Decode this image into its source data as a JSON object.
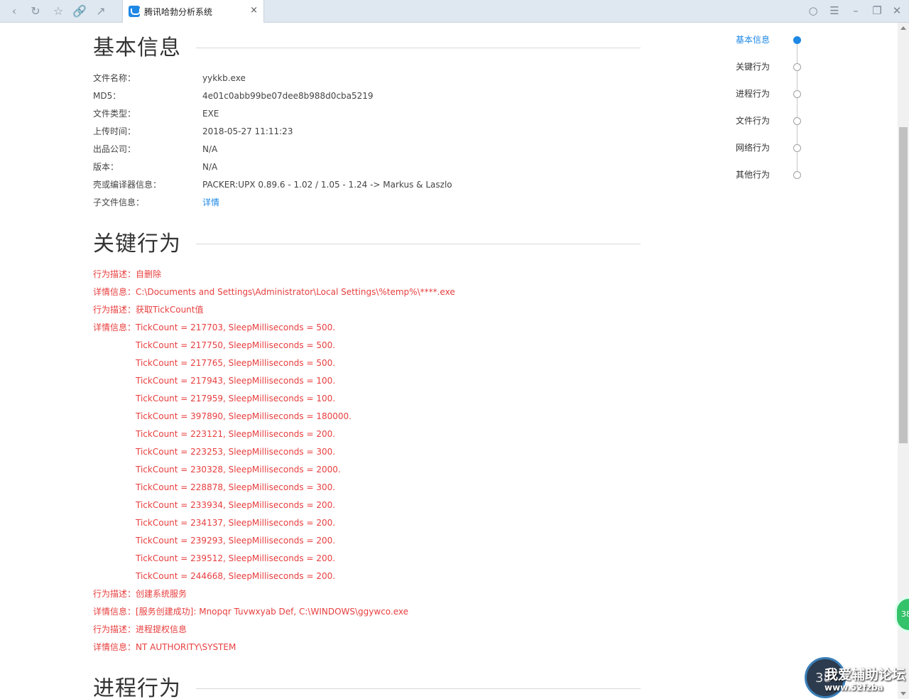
{
  "browser": {
    "tab_title": "腾讯哈勃分析系统",
    "tab_close": "×"
  },
  "basic_info": {
    "title": "基本信息",
    "rows": [
      {
        "label": "文件名称：",
        "value": "yykkb.exe"
      },
      {
        "label": "MD5：",
        "value": "4e01c0abb99be07dee8b988d0cba5219"
      },
      {
        "label": "文件类型：",
        "value": "EXE"
      },
      {
        "label": "上传时间：",
        "value": "2018-05-27 11:11:23"
      },
      {
        "label": "出品公司：",
        "value": "N/A"
      },
      {
        "label": "版本：",
        "value": "N/A"
      },
      {
        "label": "壳或编译器信息：",
        "value": "PACKER:UPX 0.89.6 - 1.02 / 1.05 - 1.24 -> Markus & Laszlo"
      },
      {
        "label": "子文件信息：",
        "value": "详情"
      }
    ]
  },
  "key_behavior": {
    "title": "关键行为",
    "rows": [
      {
        "label": "行为描述：",
        "value": "自删除"
      },
      {
        "label": "详情信息：",
        "value": "C:\\Documents and Settings\\Administrator\\Local Settings\\%temp%\\****.exe"
      },
      {
        "label": "行为描述：",
        "value": "获取TickCount值"
      },
      {
        "label": "详情信息：",
        "value": "TickCount = 217703, SleepMilliseconds = 500."
      },
      {
        "label": "",
        "value": "TickCount = 217750, SleepMilliseconds = 500."
      },
      {
        "label": "",
        "value": "TickCount = 217765, SleepMilliseconds = 500."
      },
      {
        "label": "",
        "value": "TickCount = 217943, SleepMilliseconds = 100."
      },
      {
        "label": "",
        "value": "TickCount = 217959, SleepMilliseconds = 100."
      },
      {
        "label": "",
        "value": "TickCount = 397890, SleepMilliseconds = 180000."
      },
      {
        "label": "",
        "value": "TickCount = 223121, SleepMilliseconds = 200."
      },
      {
        "label": "",
        "value": "TickCount = 223253, SleepMilliseconds = 300."
      },
      {
        "label": "",
        "value": "TickCount = 230328, SleepMilliseconds = 2000."
      },
      {
        "label": "",
        "value": "TickCount = 228878, SleepMilliseconds = 300."
      },
      {
        "label": "",
        "value": "TickCount = 233934, SleepMilliseconds = 200."
      },
      {
        "label": "",
        "value": "TickCount = 234137, SleepMilliseconds = 200."
      },
      {
        "label": "",
        "value": "TickCount = 239293, SleepMilliseconds = 200."
      },
      {
        "label": "",
        "value": "TickCount = 239512, SleepMilliseconds = 200."
      },
      {
        "label": "",
        "value": "TickCount = 244668, SleepMilliseconds = 200."
      },
      {
        "label": "行为描述：",
        "value": "创建系统服务"
      },
      {
        "label": "详情信息：",
        "value": "[服务创建成功]: Mnopqr Tuvwxyab Def, C:\\WINDOWS\\ggywco.exe"
      },
      {
        "label": "行为描述：",
        "value": "进程提权信息"
      },
      {
        "label": "详情信息：",
        "value": "NT AUTHORITY\\SYSTEM"
      }
    ]
  },
  "process_behavior": {
    "title": "进程行为"
  },
  "sidenav": {
    "items": [
      {
        "label": "基本信息",
        "active": true
      },
      {
        "label": "关键行为",
        "active": false
      },
      {
        "label": "进程行为",
        "active": false
      },
      {
        "label": "文件行为",
        "active": false
      },
      {
        "label": "网络行为",
        "active": false
      },
      {
        "label": "其他行为",
        "active": false
      }
    ]
  },
  "overlay": {
    "badge": "38",
    "watermark_number": "38",
    "watermark_title": "我爱辅助论坛",
    "watermark_url": "www.52fzba"
  },
  "colors": {
    "accent": "#1e88e5",
    "alert": "#e83e3e"
  }
}
